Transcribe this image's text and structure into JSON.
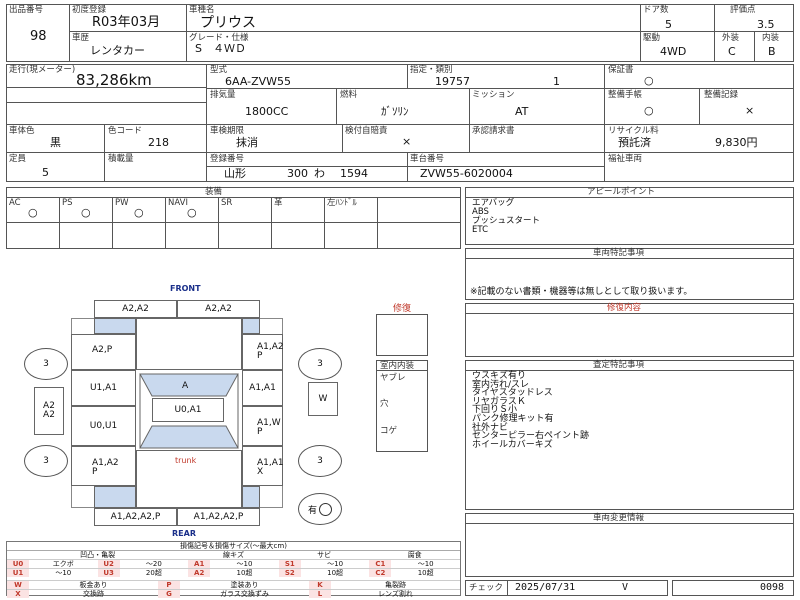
{
  "header": {
    "lot_label": "出品番号",
    "lot": "98",
    "reg_label": "初度登録",
    "reg": "R03年03月",
    "model_label": "車種名",
    "model": "プリウス",
    "history_label": "車歴",
    "history": "レンタカー",
    "grade_label": "グレード・仕様",
    "grade": "S　４ＷＤ",
    "doors_label": "ドア数",
    "doors": "5",
    "drive_label": "駆動",
    "drive": "4WD",
    "score_label": "評価点",
    "score": "3.5",
    "ext_label": "外装",
    "ext": "C",
    "int_label": "内装",
    "int": "B"
  },
  "specs": {
    "mileage_label": "走行(現メーター)",
    "mileage": "83,286km",
    "type_label": "型式",
    "type": "6AA-ZVW55",
    "designation_label": "指定・類別",
    "designation": "19757",
    "classification": "1",
    "warranty_label": "保証書",
    "warranty": "○",
    "displacement_label": "排気量",
    "displacement": "1800CC",
    "fuel_label": "燃料",
    "fuel": "ｶﾞｿﾘﾝ",
    "mission_label": "ミッション",
    "mission": "AT",
    "manual_label": "整備手帳",
    "manual": "○",
    "record_label": "整備記録",
    "record": "×",
    "color_label": "車体色",
    "color": "黒",
    "color_code_label": "色コード",
    "color_code": "218",
    "inspection_label": "車検期限",
    "inspection": "抹消",
    "liability_label": "検付自賠責",
    "liability": "×",
    "claim_label": "承認請求書",
    "claim": "",
    "recycle_label": "リサイクル料",
    "recycle_status": "預託済",
    "recycle_fee": "9,830円",
    "capacity_label": "定員",
    "capacity": "5",
    "load_label": "積載量",
    "load": "",
    "plate_label": "登録番号",
    "plate_region": "山形",
    "plate_class": "300",
    "plate_kana": "わ",
    "plate_number": "1594",
    "chassis_label": "車台番号",
    "chassis": "ZVW55-6020004",
    "welfare_label": "福祉車両",
    "welfare": ""
  },
  "equipment": {
    "title": "装備",
    "headers": [
      "AC",
      "PS",
      "PW",
      "NAVI",
      "SR",
      "革",
      "左ﾊﾝﾄﾞﾙ"
    ],
    "values": [
      "○",
      "○",
      "○",
      "○",
      "",
      "",
      ""
    ]
  },
  "appeal": {
    "title": "アピールポイント",
    "lines": [
      "エアバッグ",
      "ABS",
      "プッシュスタート",
      "ETC"
    ]
  },
  "vehicle_notes": {
    "title": "車両特記事項",
    "text": "※記載のない書類・機器等は無しとして取り扱います。"
  },
  "repair_content": {
    "title": "修復内容"
  },
  "inspection_notes": {
    "title": "査定特記事項",
    "lines": [
      "ウスキズ有り",
      "室内汚れ/スレ",
      "タイヤスタッドレス",
      "リヤガラスＫ",
      "下回りＳ小",
      "パンク修理キット有",
      "社外ナビ",
      "センターピラー右ペイント跡",
      "ホイールカバーキズ"
    ]
  },
  "change_info": {
    "title": "車両変更情報"
  },
  "diagram": {
    "front": "FRONT",
    "rear": "REAR",
    "trunk": "trunk",
    "repair_label": "修復",
    "interior_label": "室内内装",
    "interior_rows": [
      "ヤブレ",
      "穴",
      "コゲ"
    ],
    "spare_label": "有",
    "cells": {
      "front_bumper_left": "A2,A2",
      "front_bumper_right": "A2,A2",
      "left_fender": "A2,P",
      "right_fender": "A1,A2\nP",
      "left_front_door": "U1,A1",
      "right_front_door": "A1,A1",
      "left_rear_door": "U0,U1",
      "right_rear_door": "A1,W\nP",
      "left_quarter": "A1,A2\nP",
      "right_quarter": "A1,A1\nX",
      "rear_bumper_left": "A1,A2,A2,P",
      "rear_bumper_right": "A1,A2,A2,P",
      "windshield": "A",
      "roof": "U0,A1",
      "left_side_mark": "A2\nA2",
      "right_side_mark": "W",
      "tire_fl": "3",
      "tire_fr": "3",
      "tire_rl": "3",
      "tire_rr": "3"
    }
  },
  "legend": {
    "title": "損傷記号＆損傷サイズ(～最大cm)",
    "groups": [
      "凹凸・亀裂",
      "線キズ",
      "サビ",
      "腐食"
    ],
    "rows": [
      [
        {
          "c": "U0",
          "t": "エクボ"
        },
        {
          "c": "U2",
          "t": "～20"
        },
        {
          "c": "A1",
          "t": "～10"
        },
        {
          "c": "S1",
          "t": "～10"
        },
        {
          "c": "C1",
          "t": "～10"
        }
      ],
      [
        {
          "c": "U1",
          "t": "～10"
        },
        {
          "c": "U3",
          "t": "20超"
        },
        {
          "c": "A2",
          "t": "10超"
        },
        {
          "c": "S2",
          "t": "10超"
        },
        {
          "c": "C2",
          "t": "10超"
        }
      ]
    ],
    "bottom": [
      [
        {
          "c": "W",
          "t": "板金あり"
        },
        {
          "c": "P",
          "t": "塗装あり"
        },
        {
          "c": "K",
          "t": "亀裂跡"
        }
      ],
      [
        {
          "c": "X",
          "t": "交換跡"
        },
        {
          "c": "G",
          "t": "ガラス交換ずみ"
        },
        {
          "c": "L",
          "t": "レンズ割れ"
        }
      ]
    ]
  },
  "footer": {
    "check_label": "チェック",
    "check_date": "2025/07/31",
    "check_mark": "V",
    "code": "0098"
  },
  "colors": {
    "accent_red": "#c0392b",
    "panel_blue": "#c9d9ee",
    "diagram_blue": "#1a2f8a"
  }
}
